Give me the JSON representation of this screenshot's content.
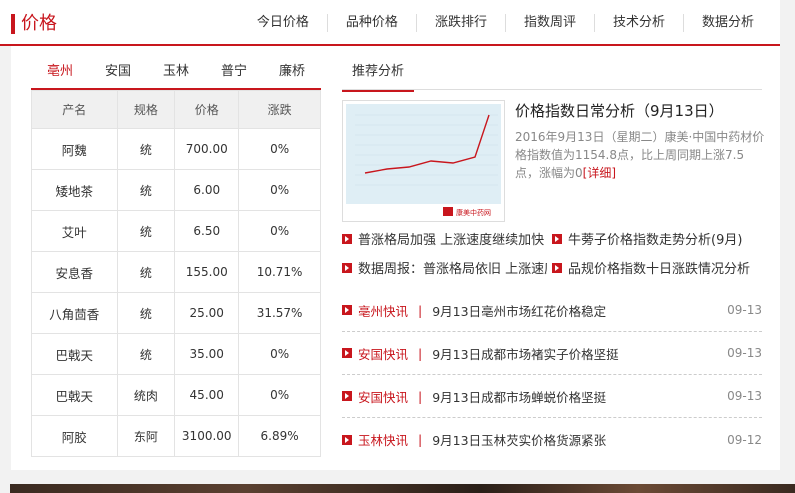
{
  "header": {
    "title": "价格",
    "nav": [
      "今日价格",
      "品种价格",
      "涨跌排行",
      "指数周评",
      "技术分析",
      "数据分析"
    ]
  },
  "left": {
    "tabs": [
      "亳州",
      "安国",
      "玉林",
      "普宁",
      "廉桥"
    ],
    "table": {
      "headers": [
        "产名",
        "规格",
        "价格",
        "涨跌"
      ],
      "rows": [
        [
          "阿魏",
          "统",
          "700.00",
          "0%"
        ],
        [
          "矮地茶",
          "统",
          "6.00",
          "0%"
        ],
        [
          "艾叶",
          "统",
          "6.50",
          "0%"
        ],
        [
          "安息香",
          "统",
          "155.00",
          "10.71%"
        ],
        [
          "八角茴香",
          "统",
          "25.00",
          "31.57%"
        ],
        [
          "巴戟天",
          "统",
          "35.00",
          "0%"
        ],
        [
          "巴戟天",
          "统肉",
          "45.00",
          "0%"
        ],
        [
          "阿胶",
          "东阿",
          "3100.00",
          "6.89%"
        ]
      ]
    }
  },
  "right": {
    "tab": "推荐分析",
    "feature": {
      "title": "价格指数日常分析（9月13日）",
      "desc": "2016年9月13日（星期二）康美·中国中药材价格指数值为1154.8点，比上周同期上涨7.5点，涨幅为0",
      "more": "[详细]",
      "thumb_logo": "康美中药网"
    },
    "links": [
      "普涨格局加强 上涨速度继续加快",
      "牛蒡子价格指数走势分析(9月)",
      "数据周报：普涨格局依旧 上涨速度",
      "品规价格指数十日涨跌情况分析"
    ],
    "news": [
      {
        "cat": "亳州快讯",
        "title": "9月13日亳州市场红花价格稳定",
        "date": "09-13"
      },
      {
        "cat": "安国快讯",
        "title": "9月13日成都市场褚实子价格坚挺",
        "date": "09-13"
      },
      {
        "cat": "安国快讯",
        "title": "9月13日成都市场蝉蜕价格坚挺",
        "date": "09-13"
      },
      {
        "cat": "玉林快讯",
        "title": "9月13日玉林芡实价格货源紧张",
        "date": "09-12"
      }
    ]
  },
  "colors": {
    "accent": "#c8161d"
  }
}
